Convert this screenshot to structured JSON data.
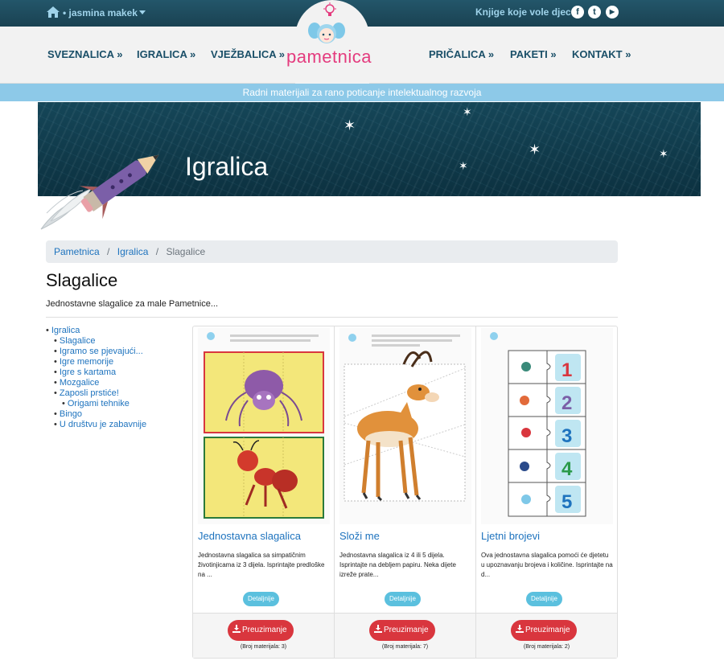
{
  "topbar": {
    "user": "jasmina makek",
    "books_link": "Knjige koje vole djecu",
    "social": [
      "f",
      "t",
      "▶"
    ]
  },
  "nav": {
    "left": [
      "SVEZNALICA »",
      "IGRALICA »",
      "VJEŽBALICA »"
    ],
    "right": [
      "PRIČALICA »",
      "PAKETI »",
      "KONTAKT »"
    ],
    "logo": "pametnica"
  },
  "tagline": "Radni materijali za rano poticanje intelektualnog razvoja",
  "banner": {
    "title": "Igralica"
  },
  "breadcrumb": {
    "home": "Pametnica",
    "parent": "Igralica",
    "current": "Slagalice",
    "sep": "/"
  },
  "page": {
    "title": "Slagalice",
    "description": "Jednostavne slagalice za male Pametnice..."
  },
  "sidebar": {
    "root": "Igralica",
    "items": [
      "Slagalice",
      "Igramo se pjevajući...",
      "Igre memorije",
      "Igre s kartama",
      "Mozgalice",
      "Zaposli prstiće!"
    ],
    "subitem": "Origami tehnike",
    "items_after": [
      "Bingo",
      "U društvu je zabavnije"
    ]
  },
  "cards": [
    {
      "title": "Jednostavna slagalica",
      "description": "Jednostavna slagalica sa simpatičnim životinjicama iz 3 dijela. Isprintajte predloške na ...",
      "details_label": "Detaljnije",
      "download_label": "Preuzimanje",
      "count_label": "(Broj materijala: 3)"
    },
    {
      "title": "Složi me",
      "description": "Jednostavna slagalica iz 4 ili 5 dijela. Isprintajte na debljem papiru. Neka dijete izreže prate...",
      "details_label": "Detaljnije",
      "download_label": "Preuzimanje",
      "count_label": "(Broj materijala: 7)"
    },
    {
      "title": "Ljetni brojevi",
      "description": "Ova jednostavna slagalica pomoći će djetetu u upoznavanju brojeva i količine. Isprintajte na d...",
      "details_label": "Detaljnije",
      "download_label": "Preuzimanje",
      "count_label": "(Broj materijala: 2)"
    }
  ],
  "colors": {
    "topbar": "#1d4a5c",
    "nav_text": "#1a4f68",
    "logo_pink": "#e43b7e",
    "tagline_bg": "#8dc9e8",
    "link_blue": "#1e73be",
    "details_bg": "#5bc0de",
    "download_bg": "#d9363e"
  },
  "icons": {
    "home": "home-icon",
    "caret": "caret-down-icon",
    "facebook": "facebook-icon",
    "twitter": "twitter-icon",
    "youtube": "youtube-icon",
    "download": "download-icon"
  }
}
